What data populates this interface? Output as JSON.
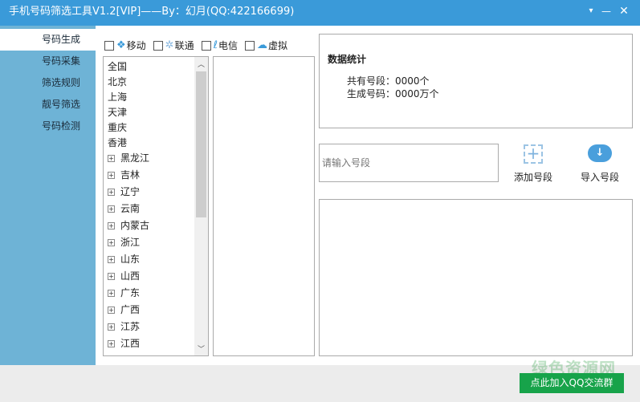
{
  "window": {
    "title": "手机号码筛选工具V1.2[VIP]——By：幻月(QQ:422166699)",
    "menu_icon": "▾",
    "min_icon": "—",
    "close_icon": "✕"
  },
  "sidebar": {
    "items": [
      {
        "label": "号码生成"
      },
      {
        "label": "号码采集"
      },
      {
        "label": "筛选规则"
      },
      {
        "label": "靓号筛选"
      },
      {
        "label": "号码检测"
      }
    ]
  },
  "carriers": [
    {
      "label": "移动",
      "icon": "china-mobile-icon"
    },
    {
      "label": "联通",
      "icon": "china-unicom-icon"
    },
    {
      "label": "电信",
      "icon": "china-telecom-icon"
    },
    {
      "label": "虚拟",
      "icon": "cloud-icon"
    }
  ],
  "regions": [
    {
      "label": "全国",
      "expandable": false
    },
    {
      "label": "北京",
      "expandable": false
    },
    {
      "label": "上海",
      "expandable": false
    },
    {
      "label": "天津",
      "expandable": false
    },
    {
      "label": "重庆",
      "expandable": false
    },
    {
      "label": "香港",
      "expandable": false
    },
    {
      "label": "黑龙江",
      "expandable": true
    },
    {
      "label": "吉林",
      "expandable": true
    },
    {
      "label": "辽宁",
      "expandable": true
    },
    {
      "label": "云南",
      "expandable": true
    },
    {
      "label": "内蒙古",
      "expandable": true
    },
    {
      "label": "浙江",
      "expandable": true
    },
    {
      "label": "山东",
      "expandable": true
    },
    {
      "label": "山西",
      "expandable": true
    },
    {
      "label": "广东",
      "expandable": true
    },
    {
      "label": "广西",
      "expandable": true
    },
    {
      "label": "江苏",
      "expandable": true
    },
    {
      "label": "江西",
      "expandable": true
    }
  ],
  "stats": {
    "title": "数据统计",
    "segments": "共有号段：0000个",
    "generated": "生成号码：0000万个"
  },
  "segment_input": {
    "placeholder": "请输入号段"
  },
  "actions": {
    "add": "添加号段",
    "import": "导入号段"
  },
  "footer": {
    "qq_button": "点此加入QQ交流群",
    "watermark": "绿色资源网"
  },
  "colors": {
    "titlebar": "#3a9ad9",
    "sidebar": "#6eb3d6",
    "button": "#17a34a"
  }
}
